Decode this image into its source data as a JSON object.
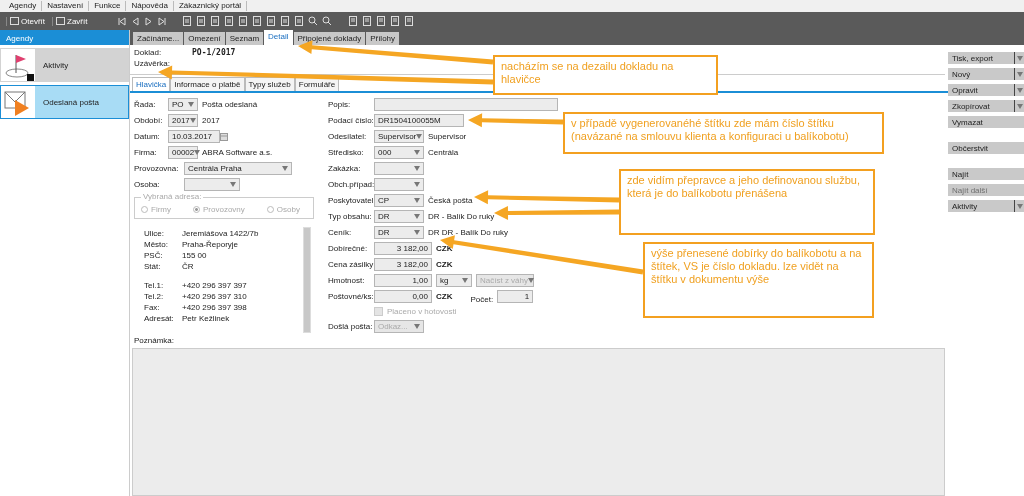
{
  "menu": [
    "Agendy",
    "Nastavení",
    "Funkce",
    "Nápověda",
    "Zákaznický portál"
  ],
  "toolbar": {
    "buttons": [
      {
        "label": "Otevřít"
      },
      {
        "label": "Zavřít"
      }
    ]
  },
  "sidebar": {
    "title": "Agendy",
    "items": [
      {
        "label": "Aktivity",
        "kind": "flag",
        "selected": false
      },
      {
        "label": "Odeslaná pošta",
        "kind": "mail",
        "selected": true
      }
    ]
  },
  "tabs": [
    {
      "label": "Začínáme...",
      "selected": false
    },
    {
      "label": "Omezení",
      "selected": false
    },
    {
      "label": "Seznam",
      "selected": false
    },
    {
      "label": "Detail",
      "selected": true
    },
    {
      "label": "Připojené doklady",
      "selected": false
    },
    {
      "label": "Přílohy",
      "selected": false
    }
  ],
  "document": [
    {
      "label": "Doklad:",
      "value": "PO-1/2017"
    },
    {
      "label": "Uzávěrka:"
    }
  ],
  "subtabs": [
    {
      "label": "Hlavička",
      "selected": true
    },
    {
      "label": "Informace o platbě",
      "selected": false
    },
    {
      "label": "Typy služeb",
      "selected": false
    },
    {
      "label": "Formuláře",
      "selected": false
    }
  ],
  "left_form": [
    {
      "label": "Řada:",
      "kind": "combo",
      "value": "PO",
      "text": "Pošta odeslaná"
    },
    {
      "label": "Období:",
      "kind": "combo",
      "value": "2017",
      "text": "2017"
    },
    {
      "label": "Datum:",
      "kind": "date",
      "value": "10.03.2017"
    },
    {
      "label": "Firma:",
      "kind": "combo",
      "value": "00002",
      "text": "ABRA Software a.s."
    },
    {
      "label": "Provozovna:",
      "kind": "wide_combo",
      "value": "Centrála Praha"
    },
    {
      "label": "Osoba:",
      "kind": "wide_combo"
    }
  ],
  "address_choice": {
    "legend": "Vybraná adresa:",
    "disabled": true,
    "options": [
      {
        "label": "Firmy",
        "selected": false
      },
      {
        "label": "Provozovny",
        "selected": true
      },
      {
        "label": "Osoby",
        "selected": false
      }
    ]
  },
  "address": [
    [
      {
        "label": "Ulice:",
        "value": "Jeremiášova 1422/7b"
      },
      {
        "label": "Město:",
        "value": "Praha-Řeporyje"
      },
      {
        "label": "PSČ:",
        "value": "155 00"
      },
      {
        "label": "Stát:",
        "value": "ČR"
      }
    ],
    [
      {
        "label": "Tel.1:",
        "value": "+420 296 397 397"
      },
      {
        "label": "Tel.2:",
        "value": "+420 296 397 310"
      },
      {
        "label": "Fax:",
        "value": "+420 296 397 398"
      },
      {
        "label": "Adresát:",
        "value": "Petr Kežlinek"
      }
    ]
  ],
  "right_form": [
    {
      "label": "Popis:",
      "kind": "wide_text"
    },
    {
      "label": "Podací číslo:",
      "kind": "text",
      "value": "DR1504100055M"
    },
    {
      "label": "Odesílatel:",
      "kind": "combo",
      "value": "Supervisor",
      "text": "Supervisor"
    },
    {
      "label": "Středisko:",
      "kind": "combo",
      "value": "000",
      "text": "Centrála"
    },
    {
      "label": "Zakázka:",
      "kind": "combo"
    },
    {
      "label": "Obch.případ:",
      "kind": "combo"
    },
    {
      "label": "Poskytovatel:",
      "kind": "combo",
      "value": "CP",
      "text": "Česká pošta"
    },
    {
      "label": "Typ obsahu:",
      "kind": "combo",
      "value": "DR",
      "text": "DR - Balík Do ruky"
    },
    {
      "label": "Ceník:",
      "kind": "combo",
      "value": "DR",
      "text": "DR DR - Balík Do ruky"
    },
    {
      "label": "Dobírečné:",
      "kind": "amount",
      "value": "3 182,00",
      "currency": "CZK"
    },
    {
      "label": "Cena zásilky:",
      "kind": "amount",
      "value": "3 182,00",
      "currency": "CZK"
    },
    {
      "label": "Hmotnost:",
      "kind": "weight",
      "value": "1,00",
      "unit": "kg",
      "button": "Načíst z váhy",
      "disabled": true
    },
    {
      "label": "Poštovné/ks:",
      "kind": "count",
      "value": "0,00",
      "currency": "CZK",
      "count_label": "Počet:",
      "count": "1"
    },
    {
      "label": "Placeno v hotovosti",
      "kind": "checkbox",
      "checked": false,
      "disabled": true
    },
    {
      "label": "Došlá pošta:",
      "kind": "combo",
      "value": "Odkaz...",
      "disabled": true
    }
  ],
  "note": {
    "label": "Poznámka:"
  },
  "actions": [
    [
      {
        "label": "Tisk, export",
        "dropdown": true,
        "disabled": false
      },
      {
        "label": "Nový",
        "dropdown": true,
        "disabled": false
      },
      {
        "label": "Opravit",
        "dropdown": true,
        "disabled": false
      },
      {
        "label": "Zkopírovat",
        "dropdown": true,
        "disabled": false
      },
      {
        "label": "Vymazat",
        "dropdown": false,
        "disabled": false
      }
    ],
    [
      {
        "label": "Občerstvit",
        "dropdown": false,
        "disabled": false
      }
    ],
    [
      {
        "label": "Najít",
        "dropdown": false,
        "disabled": false
      },
      {
        "label": "Najít další",
        "dropdown": false,
        "disabled": true
      },
      {
        "label": "Aktivity",
        "dropdown": true,
        "disabled": false
      }
    ]
  ],
  "callouts": [
    "nacházím se na dezailu dokladu na hlavičce",
    "v případě vygenerovanéhé štítku zde mám číslo štítku (navázané na smlouvu klienta a konfiguraci u balíkobotu)",
    "zde vidím přepravce a jeho definovanou službu, která je do balíkobotu přenášena",
    "výše přenesené dobírky do balíkobotu a na štítek, VS je číslo dokladu. lze vidět na štítku v dokumentu výše"
  ]
}
